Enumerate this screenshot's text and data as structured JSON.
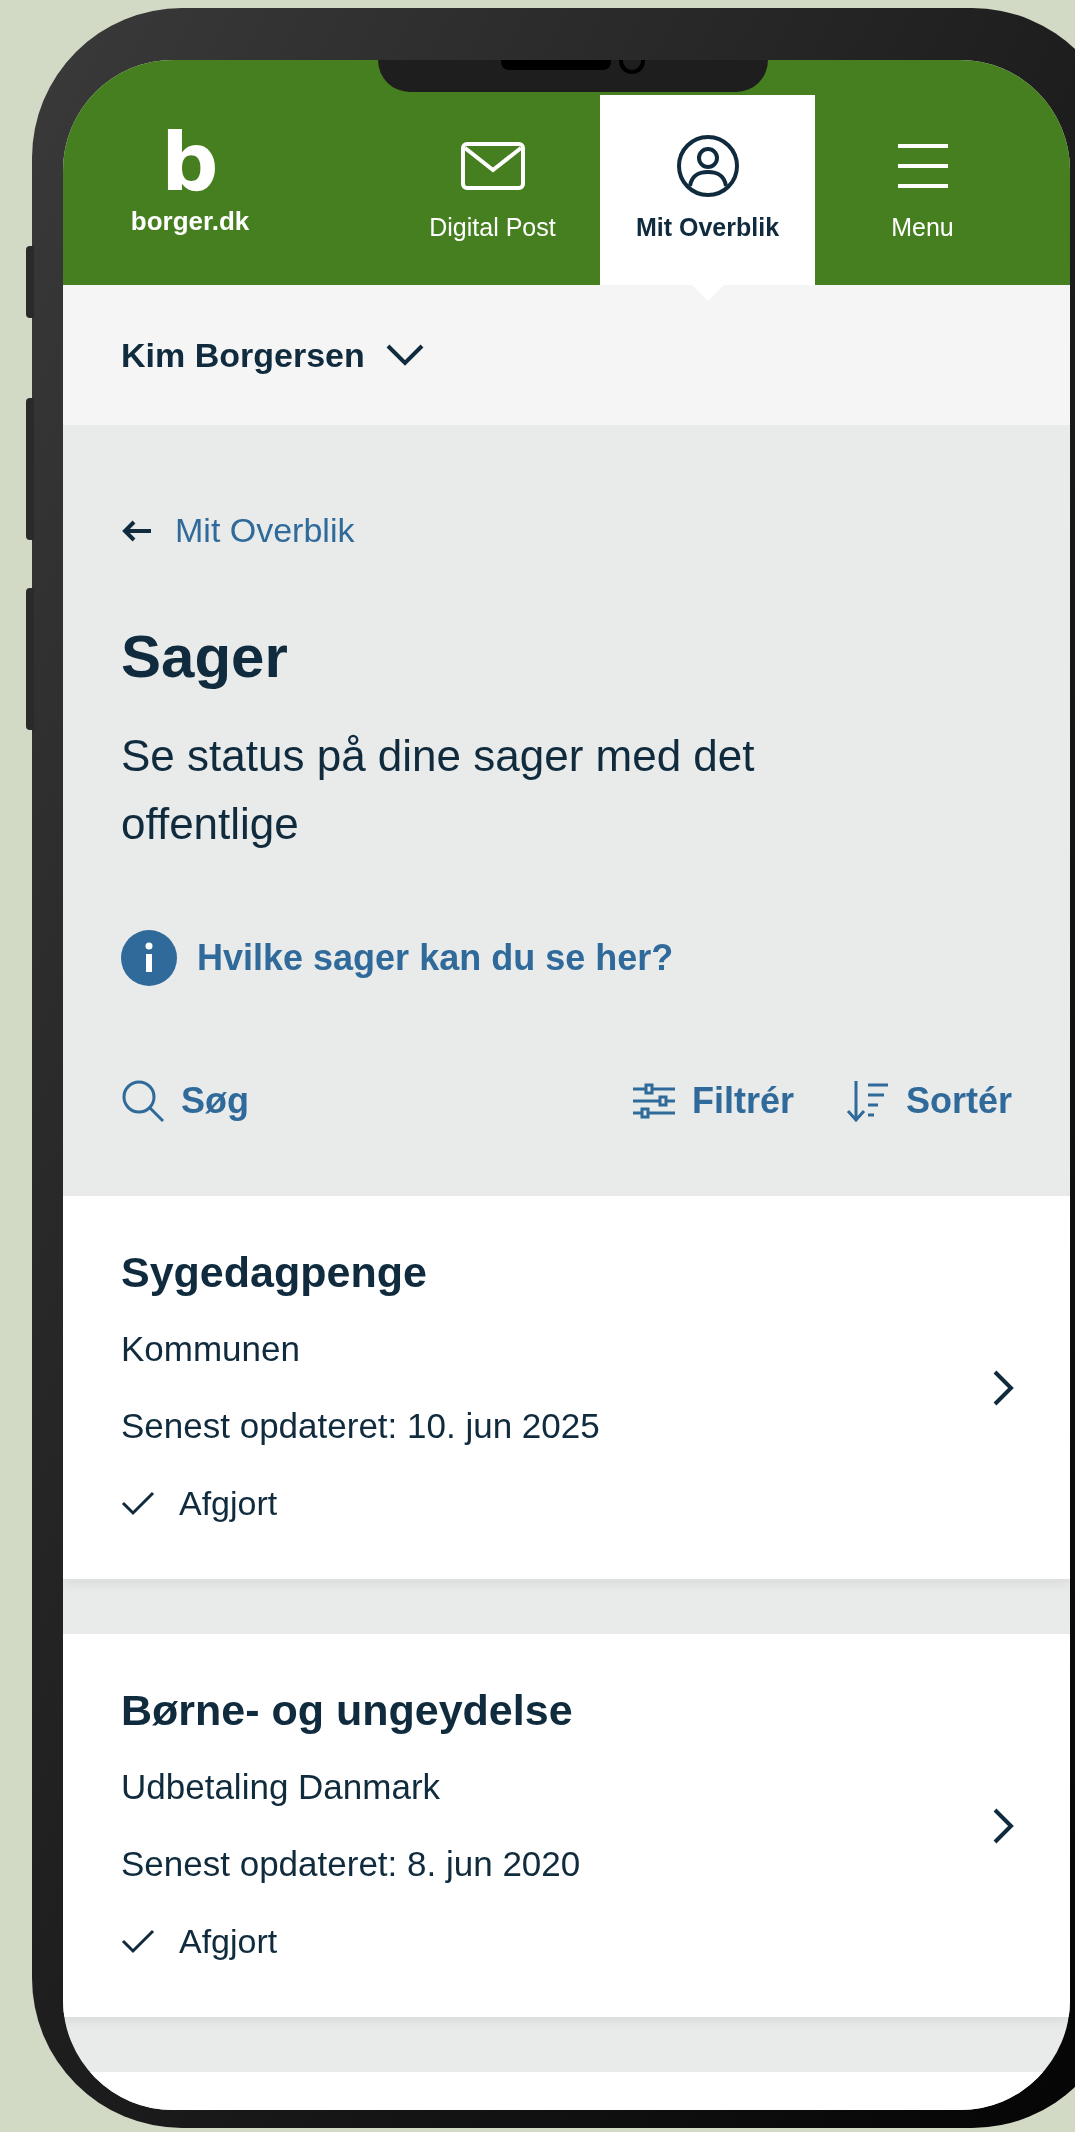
{
  "logo": {
    "mark": "b",
    "text": "borger.dk"
  },
  "nav_tabs": [
    {
      "label": "Digital Post",
      "kind": "mail",
      "selected": false
    },
    {
      "label": "Mit Overblik",
      "kind": "profile",
      "selected": true
    },
    {
      "label": "Menu",
      "kind": "menu",
      "selected": false
    }
  ],
  "user_selector": {
    "name": "Kim Borgersen"
  },
  "back_link": "Mit Overblik",
  "title": "Sager",
  "description": "Se status på dine sager med det offentlige",
  "info_link": "Hvilke sager kan du se her?",
  "toolbar": {
    "search": "Søg",
    "filter": "Filtrér",
    "sort": "Sortér"
  },
  "cases": [
    {
      "title": "Sygedagpenge",
      "authority": "Kommunen",
      "updated": "Senest opdateret: 10. jun 2025",
      "status": "Afgjort"
    },
    {
      "title": "Børne- og ungeydelse",
      "authority": "Udbetaling Danmark",
      "updated": "Senest opdateret: 8. jun 2020",
      "status": "Afgjort"
    }
  ]
}
